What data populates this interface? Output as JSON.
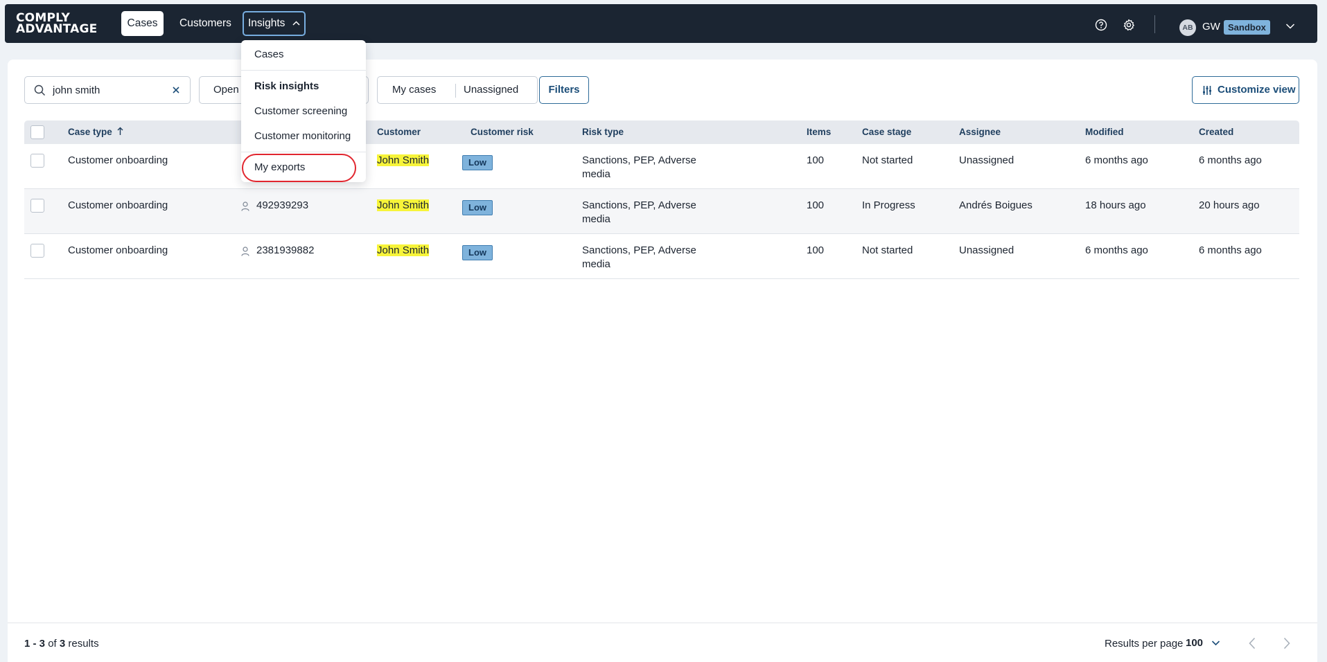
{
  "brand": {
    "line1": "COMPLY",
    "line2": "ADVANTAGE"
  },
  "nav": {
    "cases": "Cases",
    "customers": "Customers",
    "insights": "Insights"
  },
  "account": {
    "avatar_initials": "AB",
    "user_initials": "GW",
    "environment": "Sandbox"
  },
  "icons": {
    "help": "help-circle-icon",
    "settings": "gear-icon",
    "search": "search-icon",
    "clear": "close-icon",
    "customize": "sliders-icon",
    "person": "person-icon"
  },
  "colors": {
    "nav_bg": "#1b2532",
    "accent": "#2d6a98",
    "highlight": "#f7f43a",
    "low_badge": "#7fb3dc",
    "annotation": "#e1262f"
  },
  "toolbar": {
    "search_value": "john smith",
    "status_value": "Open",
    "my_cases": "My cases",
    "unassigned": "Unassigned",
    "filters": "Filters",
    "customize_view": "Customize view"
  },
  "menu": {
    "cases": "Cases",
    "risk_insights": "Risk insights",
    "customer_screening": "Customer screening",
    "customer_monitoring": "Customer monitoring",
    "my_exports": "My exports"
  },
  "table": {
    "headers": {
      "case_type": "Case type",
      "customer": "Customer",
      "customer_risk": "Customer risk",
      "risk_type": "Risk type",
      "items": "Items",
      "case_stage": "Case stage",
      "assignee": "Assignee",
      "modified": "Modified",
      "created": "Created"
    },
    "rows": [
      {
        "case_type": "Customer onboarding",
        "customer_id": "",
        "customer": "John Smith",
        "risk": "Low",
        "risk_type": "Sanctions, PEP, Adverse media",
        "items": "100",
        "stage": "Not started",
        "assignee": "Unassigned",
        "modified": "6 months ago",
        "created": "6 months ago"
      },
      {
        "case_type": "Customer onboarding",
        "customer_id": "492939293",
        "customer": "John Smith",
        "risk": "Low",
        "risk_type": "Sanctions, PEP, Adverse media",
        "items": "100",
        "stage": "In Progress",
        "assignee": "Andrés Boigues",
        "modified": "18 hours ago",
        "created": "20 hours ago"
      },
      {
        "case_type": "Customer onboarding",
        "customer_id": "2381939882",
        "customer": "John Smith",
        "risk": "Low",
        "risk_type": "Sanctions, PEP, Adverse media",
        "items": "100",
        "stage": "Not started",
        "assignee": "Unassigned",
        "modified": "6 months ago",
        "created": "6 months ago"
      }
    ]
  },
  "footer": {
    "range": "1 - 3",
    "of_label": "of",
    "total": "3",
    "results_label": "results",
    "rpp_label": "Results per page",
    "rpp_value": "100"
  }
}
